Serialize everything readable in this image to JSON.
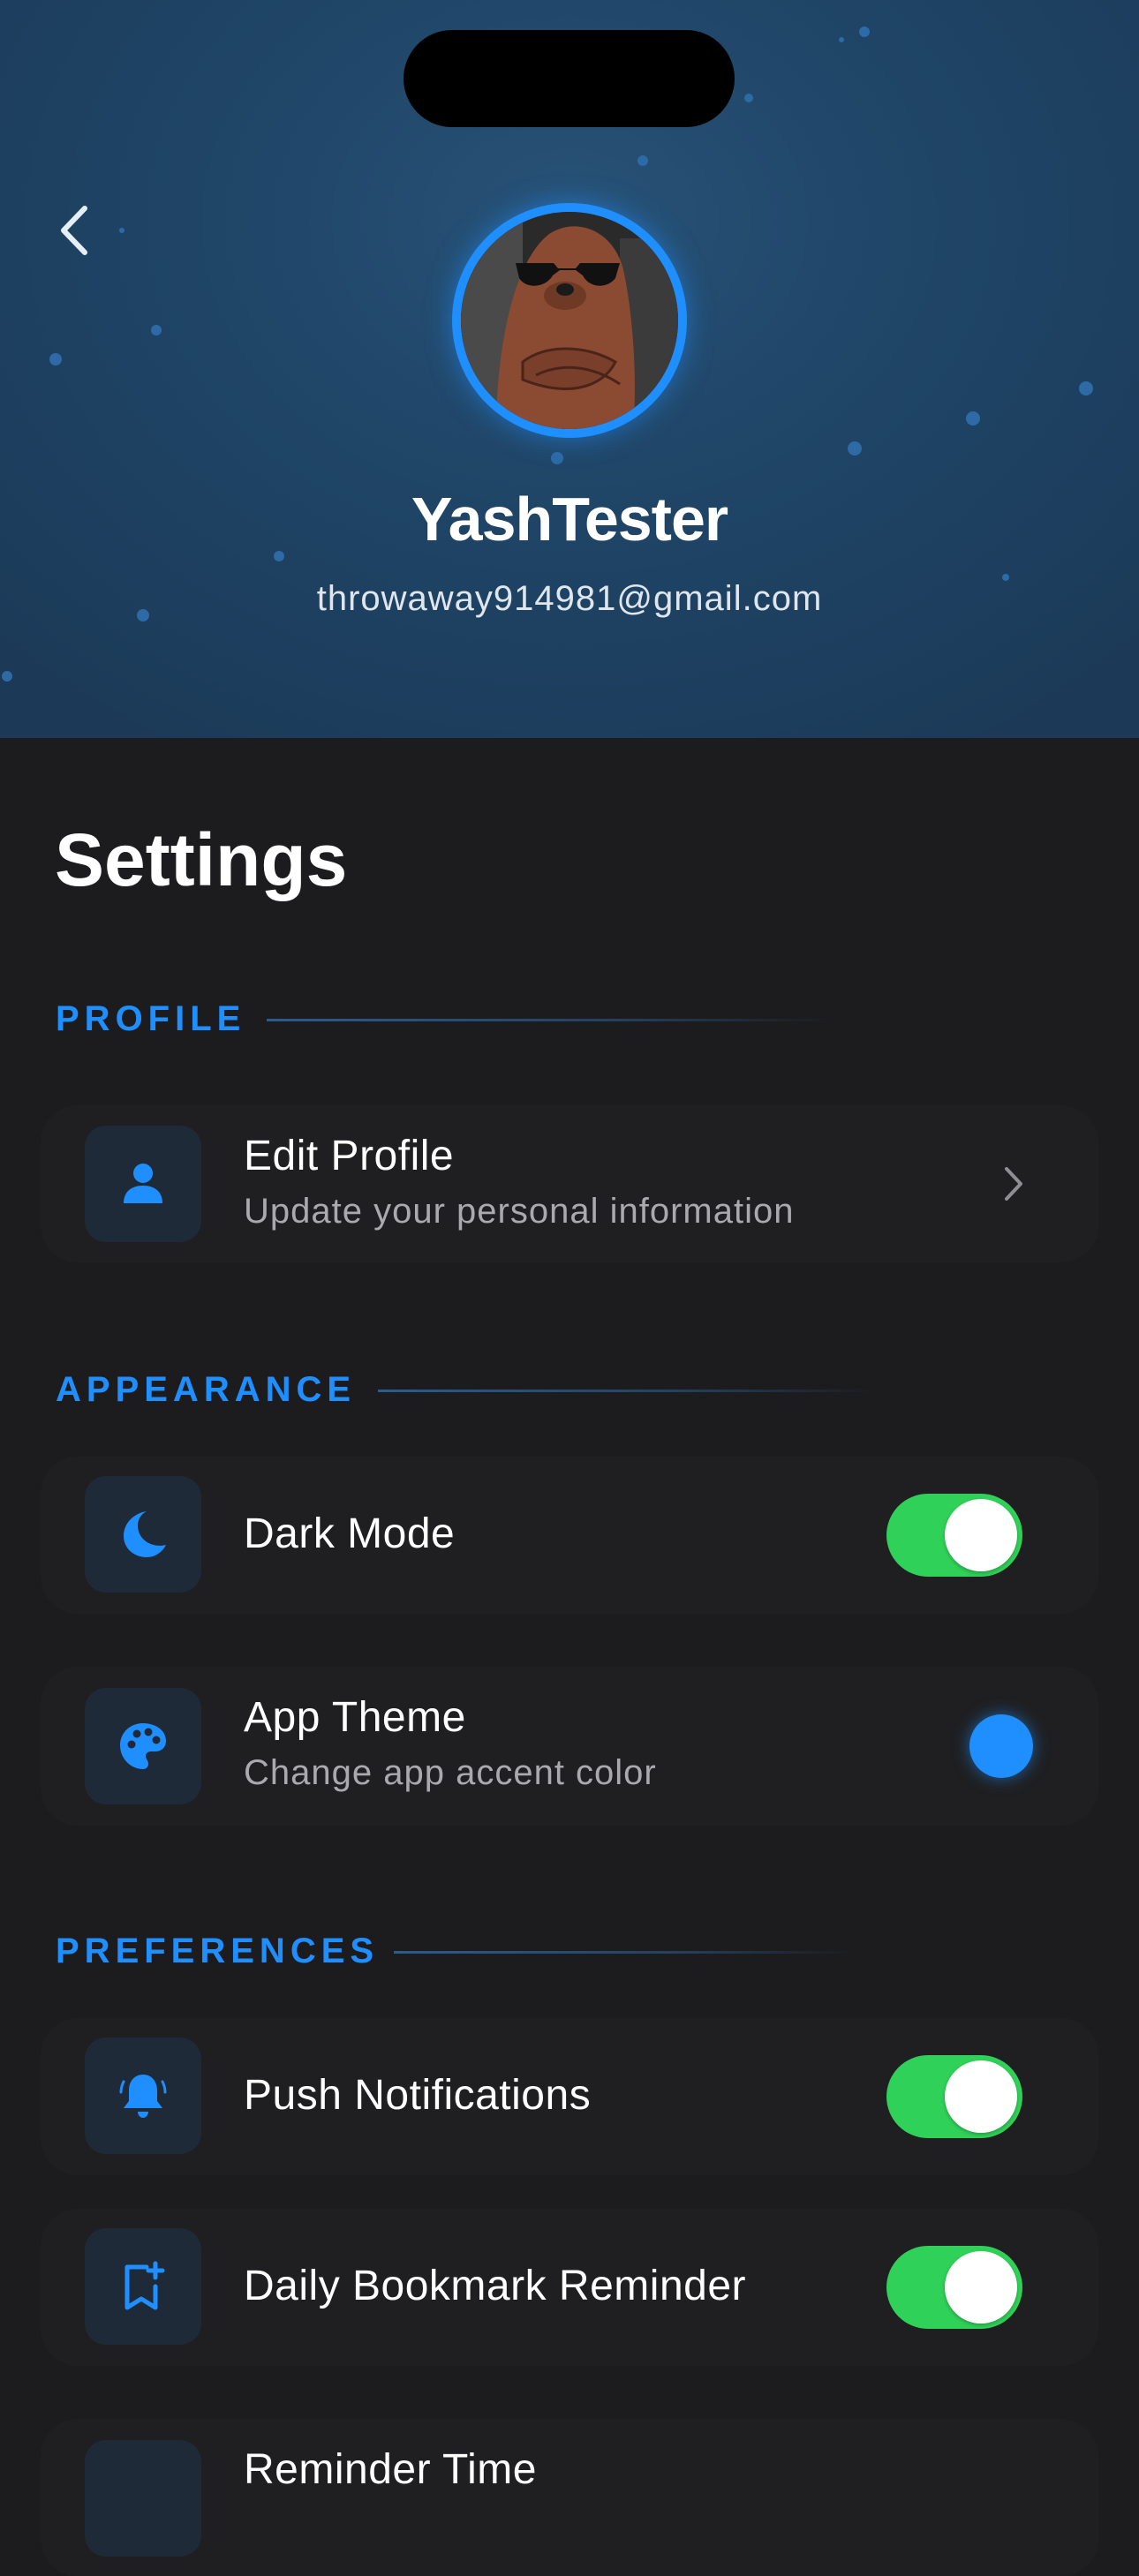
{
  "profile": {
    "name": "YashTester",
    "email": "throwaway914981@gmail.com"
  },
  "settings": {
    "title": "Settings",
    "sections": {
      "profile": "PROFILE",
      "appearance": "APPEARANCE",
      "preferences": "PREFERENCES"
    },
    "edit_profile": {
      "title": "Edit Profile",
      "subtitle": "Update your personal information"
    },
    "dark_mode": {
      "title": "Dark Mode",
      "enabled": true
    },
    "app_theme": {
      "title": "App Theme",
      "subtitle": "Change app accent color",
      "accent_color": "#1f8fff"
    },
    "push_notifications": {
      "title": "Push Notifications",
      "enabled": true
    },
    "daily_bookmark_reminder": {
      "title": "Daily Bookmark Reminder",
      "enabled": true
    },
    "reminder_time": {
      "title": "Reminder Time"
    }
  },
  "colors": {
    "accent": "#1f8fff",
    "toggle_on": "#30d158",
    "background": "#1c1c1e",
    "header_bg": "#1f4567"
  },
  "icons": [
    "back-chevron-icon",
    "person-icon",
    "chevron-right-icon",
    "moon-icon",
    "palette-icon",
    "bell-icon",
    "bookmark-plus-icon"
  ]
}
